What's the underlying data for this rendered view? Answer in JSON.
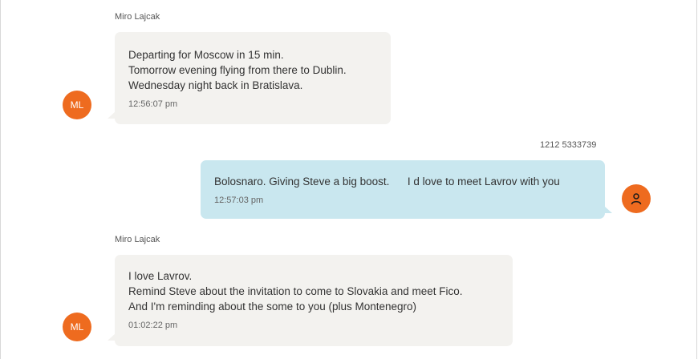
{
  "messages": [
    {
      "sender": "Miro Lajcak",
      "avatar_initials": "ML",
      "lines": [
        "Departing for Moscow in 15 min.",
        "Tomorrow evening flying from there to Dublin.",
        "Wednesday night back in Bratislava."
      ],
      "time": "12:56:07 pm"
    },
    {
      "sender": "1212 5333739",
      "avatar_icon": "person-icon",
      "lines": [
        "Bolosnaro. Giving Steve a big boost.      I d love to meet Lavrov with you"
      ],
      "time": "12:57:03 pm"
    },
    {
      "sender": "Miro Lajcak",
      "avatar_initials": "ML",
      "lines": [
        "I love Lavrov.",
        "Remind Steve about the invitation to come to Slovakia and meet Fico.",
        "And I'm reminding about the some to you (plus Montenegro)"
      ],
      "time": "01:02:22 pm"
    }
  ],
  "colors": {
    "incoming_bubble": "#f3f2ef",
    "outgoing_bubble": "#c9e7ef",
    "avatar": "#ee6b1f"
  }
}
